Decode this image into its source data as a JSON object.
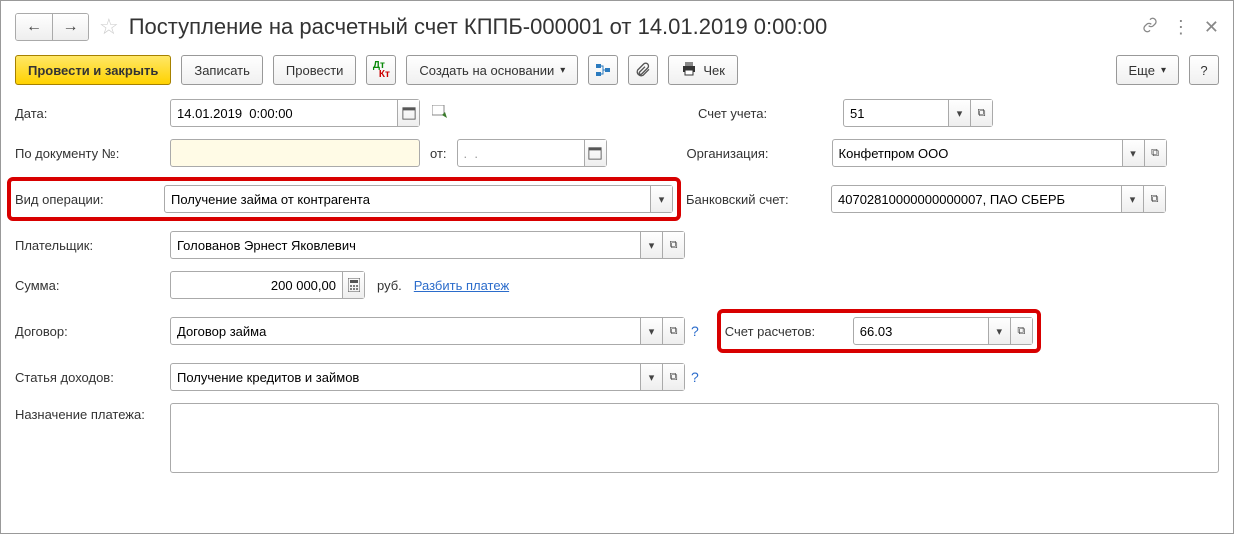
{
  "title": "Поступление на расчетный счет КППБ-000001 от 14.01.2019 0:00:00",
  "toolbar": {
    "submit_close": "Провести и закрыть",
    "save": "Записать",
    "submit": "Провести",
    "create_based": "Создать на основании",
    "cheque": "Чек",
    "more": "Еще"
  },
  "labels": {
    "date": "Дата:",
    "account": "Счет учета:",
    "by_doc": "По документу №:",
    "from": "от:",
    "org": "Организация:",
    "op_type": "Вид операции:",
    "bank_acc": "Банковский счет:",
    "payer": "Плательщик:",
    "sum": "Сумма:",
    "rub": "руб.",
    "split": "Разбить платеж",
    "contract": "Договор:",
    "calc_acc": "Счет расчетов:",
    "income": "Статья доходов:",
    "purpose": "Назначение платежа:"
  },
  "values": {
    "date": "14.01.2019  0:00:00",
    "account": "51",
    "doc_no": "",
    "doc_from": ".  .",
    "org": "Конфетпром ООО",
    "op_type": "Получение займа от контрагента",
    "bank_acc": "40702810000000000007, ПАО СБЕРБ",
    "payer": "Голованов Эрнест Яковлевич",
    "sum": "200 000,00",
    "contract": "Договор займа",
    "calc_acc": "66.03",
    "income": "Получение кредитов и займов",
    "purpose": ""
  }
}
